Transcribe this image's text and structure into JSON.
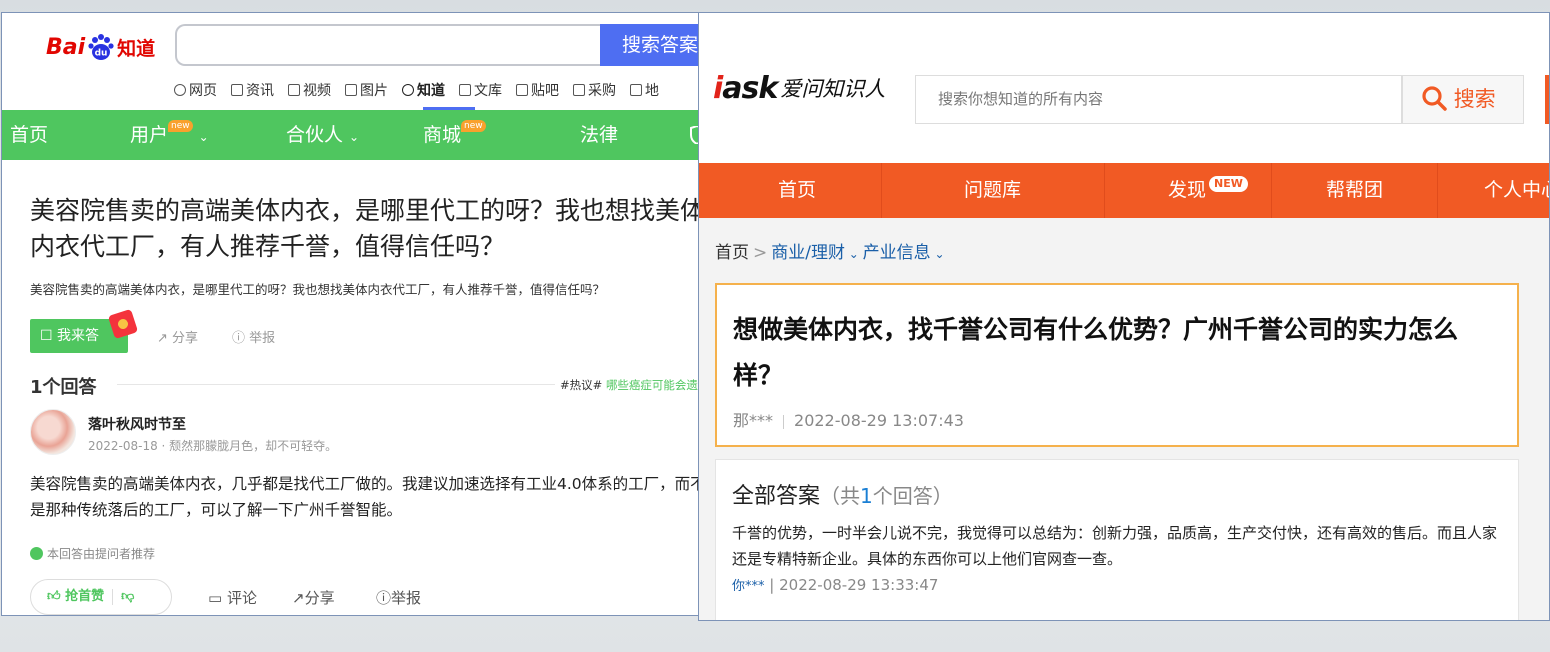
{
  "baidu": {
    "logo": {
      "bai": "Bai",
      "du": "du",
      "zhidao": "知道"
    },
    "search_placeholder": "",
    "search_button": "搜索答案",
    "nav": [
      "网页",
      "资讯",
      "视频",
      "图片",
      "知道",
      "文库",
      "贴吧",
      "采购",
      "地"
    ],
    "nav_active": "知道",
    "green_nav": [
      {
        "label": "首页",
        "badge": "",
        "caret": ""
      },
      {
        "label": "用户",
        "badge": "new",
        "caret": "⌄"
      },
      {
        "label": "合伙人",
        "badge": "",
        "caret": "⌄"
      },
      {
        "label": "商城",
        "badge": "new",
        "caret": ""
      },
      {
        "label": "法律",
        "badge": "",
        "caret": ""
      }
    ],
    "question_title": "美容院售卖的高端美体内衣，是哪里代工的呀？我也想找美体内衣代工厂，有人推荐千誉，值得信任吗？",
    "question_desc": "美容院售卖的高端美体内衣，是哪里代工的呀？我也想找美体内衣代工厂，有人推荐千誉，值得信任吗？",
    "answer_button": "我来答",
    "share": "分享",
    "report": "举报",
    "answer_count": "1个回答",
    "hot_tag": "#热议#",
    "hot_link": "哪些癌症可能会遗传？",
    "answerer_name": "落叶秋风时节至",
    "answerer_meta": "2022-08-18 · 颓然那朦胧月色，却不可轻夺。",
    "answer_text": "美容院售卖的高端美体内衣，几乎都是找代工厂做的。我建议加速选择有工业4.0体系的工厂，而不是那种传统落后的工厂，可以了解一下广州千誉智能。",
    "recommend": "本回答由提问者推荐",
    "like": "抢首赞",
    "comment": "评论",
    "share2": "分享",
    "report2": "举报"
  },
  "iask": {
    "logo_i": "i",
    "logo_ask": "ask",
    "logo_text": "爱问知识人",
    "search_placeholder": "搜索你想知道的所有内容",
    "search_button": "搜索",
    "nav": [
      "首页",
      "问题库",
      "发现",
      "帮帮团",
      "个人中心"
    ],
    "nav_new": "NEW",
    "breadcrumb": {
      "home": "首页",
      "sep": ">",
      "cat1": "商业/理财",
      "cat2": "产业信息"
    },
    "question_title": "想做美体内衣，找千誉公司有什么优势？广州千誉公司的实力怎么样？",
    "question_user": "那***",
    "question_time": "2022-08-29 13:07:43",
    "answers_header": "全部答案",
    "answers_count_prefix": "（共",
    "answers_count_num": "1",
    "answers_count_suffix": "个回答）",
    "answer_text": "千誉的优势，一时半会儿说不完，我觉得可以总结为：创新力强，品质高，生产交付快，还有高效的售后。而且人家还是专精特新企业。具体的东西你可以上他们官网查一查。",
    "answer_user": "你***",
    "answer_time": "| 2022-08-29 13:33:47"
  },
  "colors": {
    "baidu_red": "#e10601",
    "baidu_blue": "#4e6ef2",
    "zhidao_green": "#4fc65f",
    "iask_orange": "#f15a24",
    "iask_border": "#f5b14c"
  }
}
